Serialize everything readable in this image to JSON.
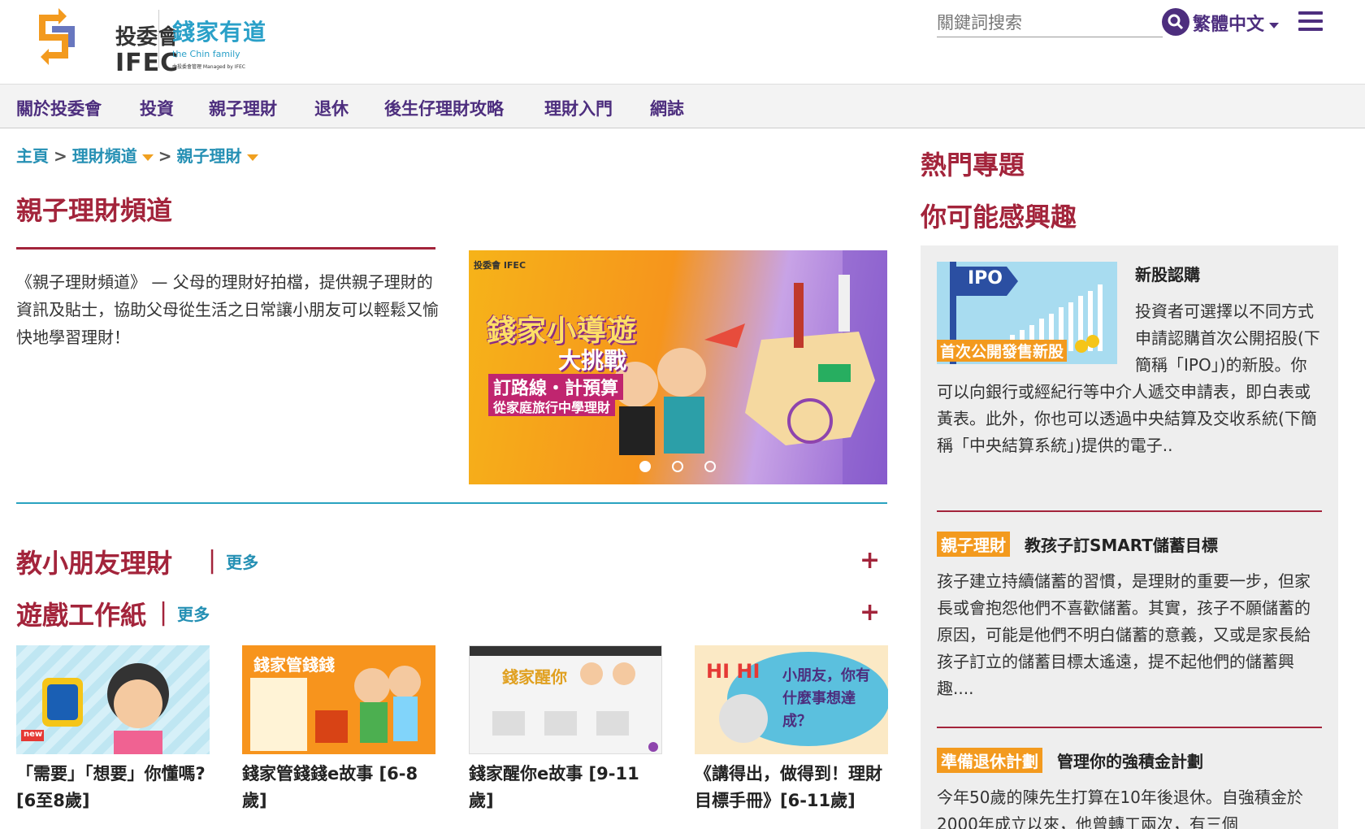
{
  "header": {
    "logo_cn": "投委會",
    "logo_en": "IFEC",
    "brand_cn": "錢家有道",
    "brand_en": "the Chin family",
    "brand_tiny": "由投委會管理 Managed by IFEC",
    "search_placeholder": "關鍵詞搜索",
    "language": "繁體中文"
  },
  "nav": [
    "關於投委會",
    "投資",
    "親子理財",
    "退休",
    "後生仔理財攻略",
    "理財入門",
    "網誌"
  ],
  "breadcrumb": {
    "home": "主頁",
    "channel": "理財頻道",
    "current": "親子理財",
    "sep": ">"
  },
  "main": {
    "title": "親子理財頻道",
    "intro": "《親子理財頻道》 — 父母的理財好拍檔，提供親子理財的資訊及貼士，協助父母從生活之日常讓小朋友可以輕鬆又愉快地學習理財！",
    "banner": {
      "logo": "投委會 IFEC",
      "title": "錢家小導遊",
      "sub": "大挑戰",
      "line1": "訂路線・計預算",
      "line2": "從家庭旅行中學理財"
    },
    "section1": {
      "title": "教小朋友理財",
      "more": "更多"
    },
    "section2": {
      "title": "遊戲工作紙",
      "more": "更多"
    },
    "cards": [
      {
        "caption": "「需要」「想要」你懂嗎? [6至8歲]",
        "badge": "new"
      },
      {
        "caption": "錢家管錢錢e故事 [6-8歲]",
        "thumb_text": "錢家管錢錢"
      },
      {
        "caption": "錢家醒你e故事 [9-11歲]",
        "thumb_text": "錢家醒你"
      },
      {
        "caption": "《講得出，做得到！理財目標手冊》[6-11歲]",
        "thumb_text": "小朋友，你有什麼事想達成？",
        "thumb_hi": "HI HI"
      }
    ]
  },
  "sidebar": {
    "hot_title": "熱門專題",
    "interest_title": "你可能感興趣",
    "items": [
      {
        "title": "新股認購",
        "thumb_label": "首次公開發售新股",
        "thumb_sign": "IPO",
        "body": "投資者可選擇以不同方式申請認購首次公開招股(下簡稱「IPO」)的新股。你可以向銀行或經紀行等中介人遞交申請表，即白表或黃表。此外，你也可以透過中央結算及交收系統(下簡稱「中央結算系統」)提供的電子.."
      },
      {
        "tag": "親子理財",
        "title": "教孩子訂SMART儲蓄目標",
        "body": "孩子建立持續儲蓄的習慣，是理財的重要一步，但家長或會抱怨他們不喜歡儲蓄。其實，孩子不願儲蓄的原因，可能是他們不明白儲蓄的意義，又或是家長給孩子訂立的儲蓄目標太遙遠，提不起他們的儲蓄興趣...."
      },
      {
        "tag": "準備退休計劃",
        "title": "管理你的強積金計劃",
        "body": "今年50歲的陳先生打算在10年後退休。自強積金於2000年成立以來，他曾轉工兩次，有三個"
      }
    ]
  },
  "colors": {
    "brand_purple": "#4d2e7e",
    "accent_red": "#a3243b",
    "link_blue": "#2590b4",
    "tag_orange": "#f39a1e"
  }
}
